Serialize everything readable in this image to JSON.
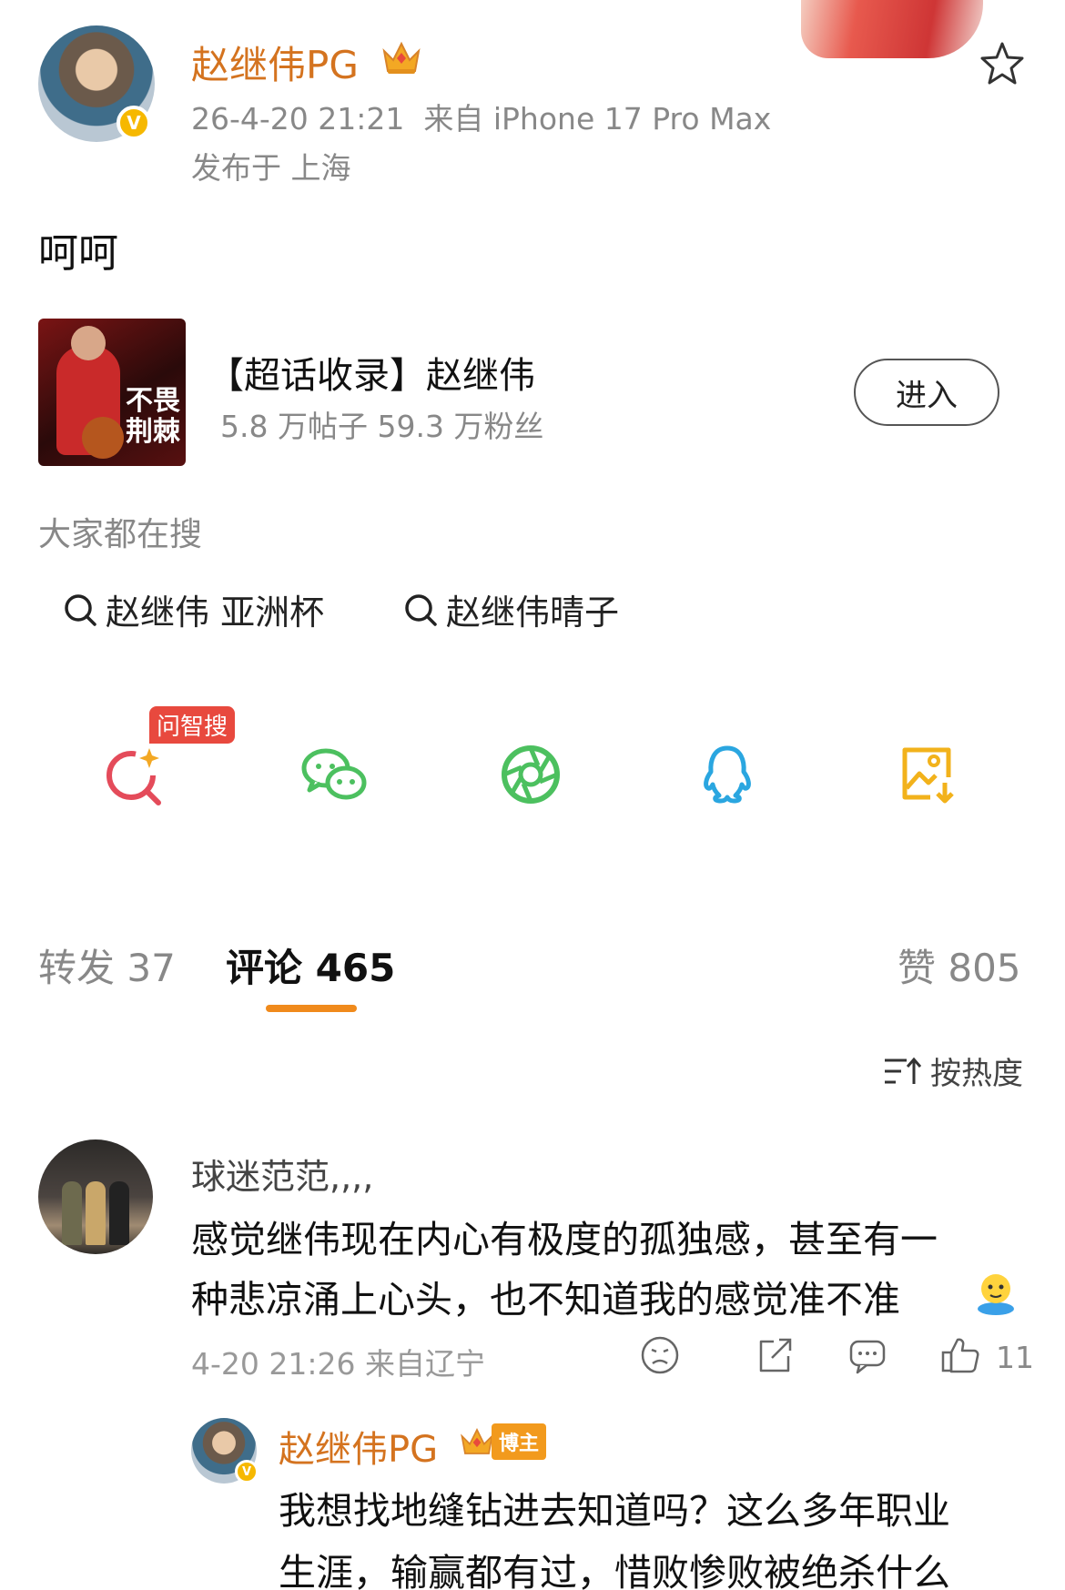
{
  "post": {
    "author": "赵继伟PG",
    "timestamp": "26-4-20 21:21",
    "source": "来自 iPhone 17 Pro Max",
    "location": "发布于 上海",
    "text": "呵呵",
    "verified_mark": "V"
  },
  "supertopic": {
    "title": "【超话收录】赵继伟",
    "stats": "5.8 万帖子 59.3 万粉丝",
    "enter_label": "进入",
    "cover_text": "不畏荆棘"
  },
  "hot_search": {
    "title": "大家都在搜",
    "items": [
      "赵继伟 亚洲杯",
      "赵继伟晴子"
    ]
  },
  "share": {
    "ai_badge": "问智搜",
    "icons": [
      "ai-search-icon",
      "wechat-icon",
      "moments-icon",
      "qq-icon",
      "save-image-icon"
    ]
  },
  "tabs": {
    "repost": "转发 37",
    "comments": "评论 465",
    "likes": "赞 805"
  },
  "sort": {
    "label": "按热度"
  },
  "comment": {
    "author": "球迷范范,,,,",
    "line1": "感觉继伟现在内心有极度的孤独感，甚至有一",
    "line2": "种悲凉涌上心头，也不知道我的感觉准不准",
    "meta": "4-20 21:26 来自辽宁",
    "like_count": "11"
  },
  "reply": {
    "author": "赵继伟PG",
    "badge": "博主",
    "line1": "我想找地缝钻进去知道吗？这么多年职业",
    "line2": "生涯，输赢都有过，惜败惨败被绝杀什么"
  },
  "colors": {
    "accent_orange": "#f08a1c",
    "name_orange": "#d4731f",
    "ai_red": "#e8493e",
    "wechat_green": "#4cc05f",
    "qq_blue": "#2aa6e0",
    "save_yellow": "#f2b21b"
  }
}
